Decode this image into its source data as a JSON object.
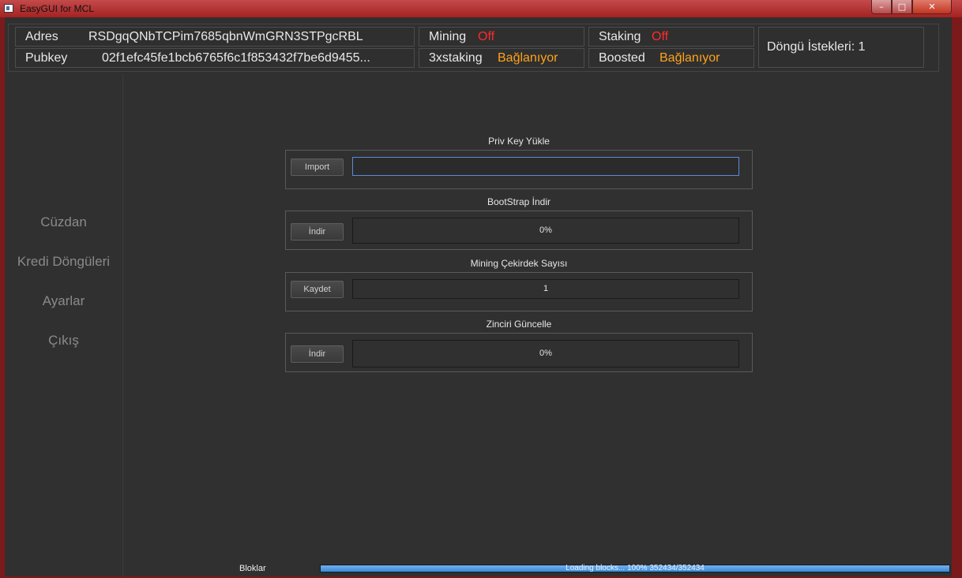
{
  "window": {
    "title": "EasyGUI for MCL",
    "min_glyph": "–",
    "max_glyph": "□",
    "close_glyph": "✕"
  },
  "header": {
    "address_label": "Adres",
    "address_value": "RSDgqQNbTCPim7685qbnWmGRN3STPgcRBL",
    "pubkey_label": "Pubkey",
    "pubkey_value": "02f1efc45fe1bcb6765f6c1f853432f7be6d9455...",
    "mining_label": "Mining",
    "mining_value": "Off",
    "staking_label": "Staking",
    "staking_value": "Off",
    "threex_label": "3xstaking",
    "threex_value": "Bağlanıyor",
    "boosted_label": "Boosted",
    "boosted_value": "Bağlanıyor",
    "cycle_requests": "Döngü İstekleri: 1"
  },
  "sidebar": {
    "items": [
      {
        "label": "Cüzdan"
      },
      {
        "label": "Kredi Döngüleri"
      },
      {
        "label": "Ayarlar"
      },
      {
        "label": "Çıkış"
      }
    ]
  },
  "sections": {
    "privkey": {
      "title": "Priv Key Yükle",
      "button": "Import",
      "input_value": ""
    },
    "bootstrap": {
      "title": "BootStrap İndir",
      "button": "İndir",
      "progress_text": "0%",
      "progress": 0
    },
    "mining_cores": {
      "title": "Mining Çekirdek Sayısı",
      "button": "Kaydet",
      "value": "1"
    },
    "update_chain": {
      "title": "Zinciri Güncelle",
      "button": "İndir",
      "progress_text": "0%",
      "progress": 0
    }
  },
  "statusbar": {
    "label": "Bloklar",
    "progress_text": "Loading blocks...  100%  352434/352434",
    "progress": 1.0
  },
  "colors": {
    "off": "#ff2a2a",
    "connecting": "#ffa31a",
    "accent": "#3b8ad8"
  }
}
